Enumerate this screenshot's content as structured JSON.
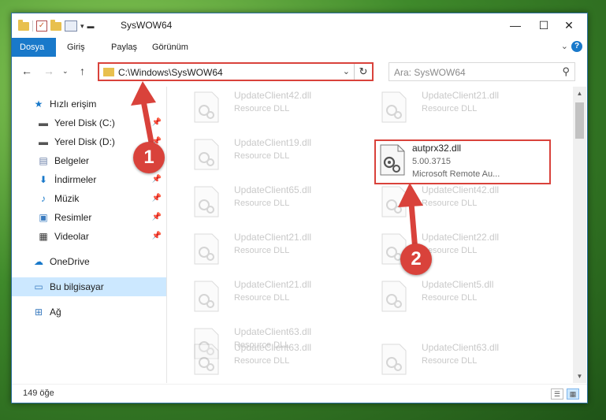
{
  "window": {
    "title": "SysWOW64",
    "minimize": "—",
    "maximize": "☐",
    "close": "✕"
  },
  "ribbon": {
    "tabs": [
      {
        "label": "Dosya",
        "active": true
      },
      {
        "label": "Giriş"
      },
      {
        "label": "Paylaş"
      },
      {
        "label": "Görünüm"
      }
    ],
    "help": "?"
  },
  "address": {
    "path": "C:\\Windows\\SysWOW64",
    "search_placeholder": "Ara: SysWOW64"
  },
  "nav_pane": {
    "items": [
      {
        "label": "Hızlı erişim",
        "icon": "star-icon",
        "pinned": false
      },
      {
        "label": "Yerel Disk (C:)",
        "icon": "drive-icon",
        "pinned": true
      },
      {
        "label": "Yerel Disk (D:)",
        "icon": "drive-icon",
        "pinned": true
      },
      {
        "label": "Belgeler",
        "icon": "documents-icon",
        "pinned": true
      },
      {
        "label": "İndirmeler",
        "icon": "download-icon",
        "pinned": true
      },
      {
        "label": "Müzik",
        "icon": "music-icon",
        "pinned": true
      },
      {
        "label": "Resimler",
        "icon": "pictures-icon",
        "pinned": true
      },
      {
        "label": "Videolar",
        "icon": "videos-icon",
        "pinned": true
      },
      {
        "label": "OneDrive",
        "icon": "cloud-icon",
        "pinned": false
      },
      {
        "label": "Bu bilgisayar",
        "icon": "computer-icon",
        "pinned": false,
        "selected": true
      },
      {
        "label": "Ağ",
        "icon": "network-icon",
        "pinned": false
      }
    ]
  },
  "files": {
    "left_column": [
      {
        "name": "UpdateClient42.dll",
        "type": "Resource DLL"
      },
      {
        "name": "UpdateClient19.dll",
        "type": "Resource DLL"
      },
      {
        "name": "UpdateClient65.dll",
        "type": "Resource DLL"
      },
      {
        "name": "UpdateClient21.dll",
        "type": "Resource DLL"
      },
      {
        "name": "UpdateClient21.dll",
        "type": "Resource DLL"
      },
      {
        "name": "UpdateClient63.dll",
        "type": "Resource DLL"
      },
      {
        "name": "UpdateClient63.dll",
        "type": "Resource DLL"
      }
    ],
    "right_column": [
      {
        "name": "UpdateClient21.dll",
        "type": "Resource DLL"
      },
      {
        "name": "UpdateClient42.dll",
        "type": "Resource DLL"
      },
      {
        "name": "UpdateClient22.dll",
        "type": "Resource DLL"
      },
      {
        "name": "UpdateClient5.dll",
        "type": "Resource DLL"
      },
      {
        "name": "UpdateClient63.dll",
        "type": "Resource DLL"
      }
    ],
    "highlighted": {
      "name": "autprx32.dll",
      "version": "5.00.3715",
      "description": "Microsoft Remote Au..."
    }
  },
  "status": {
    "count": "149 öğe"
  },
  "annotations": {
    "step1": "1",
    "step2": "2"
  },
  "colors": {
    "accent": "#1979ca",
    "annotation": "#d9423b",
    "selection": "#cce8ff"
  }
}
